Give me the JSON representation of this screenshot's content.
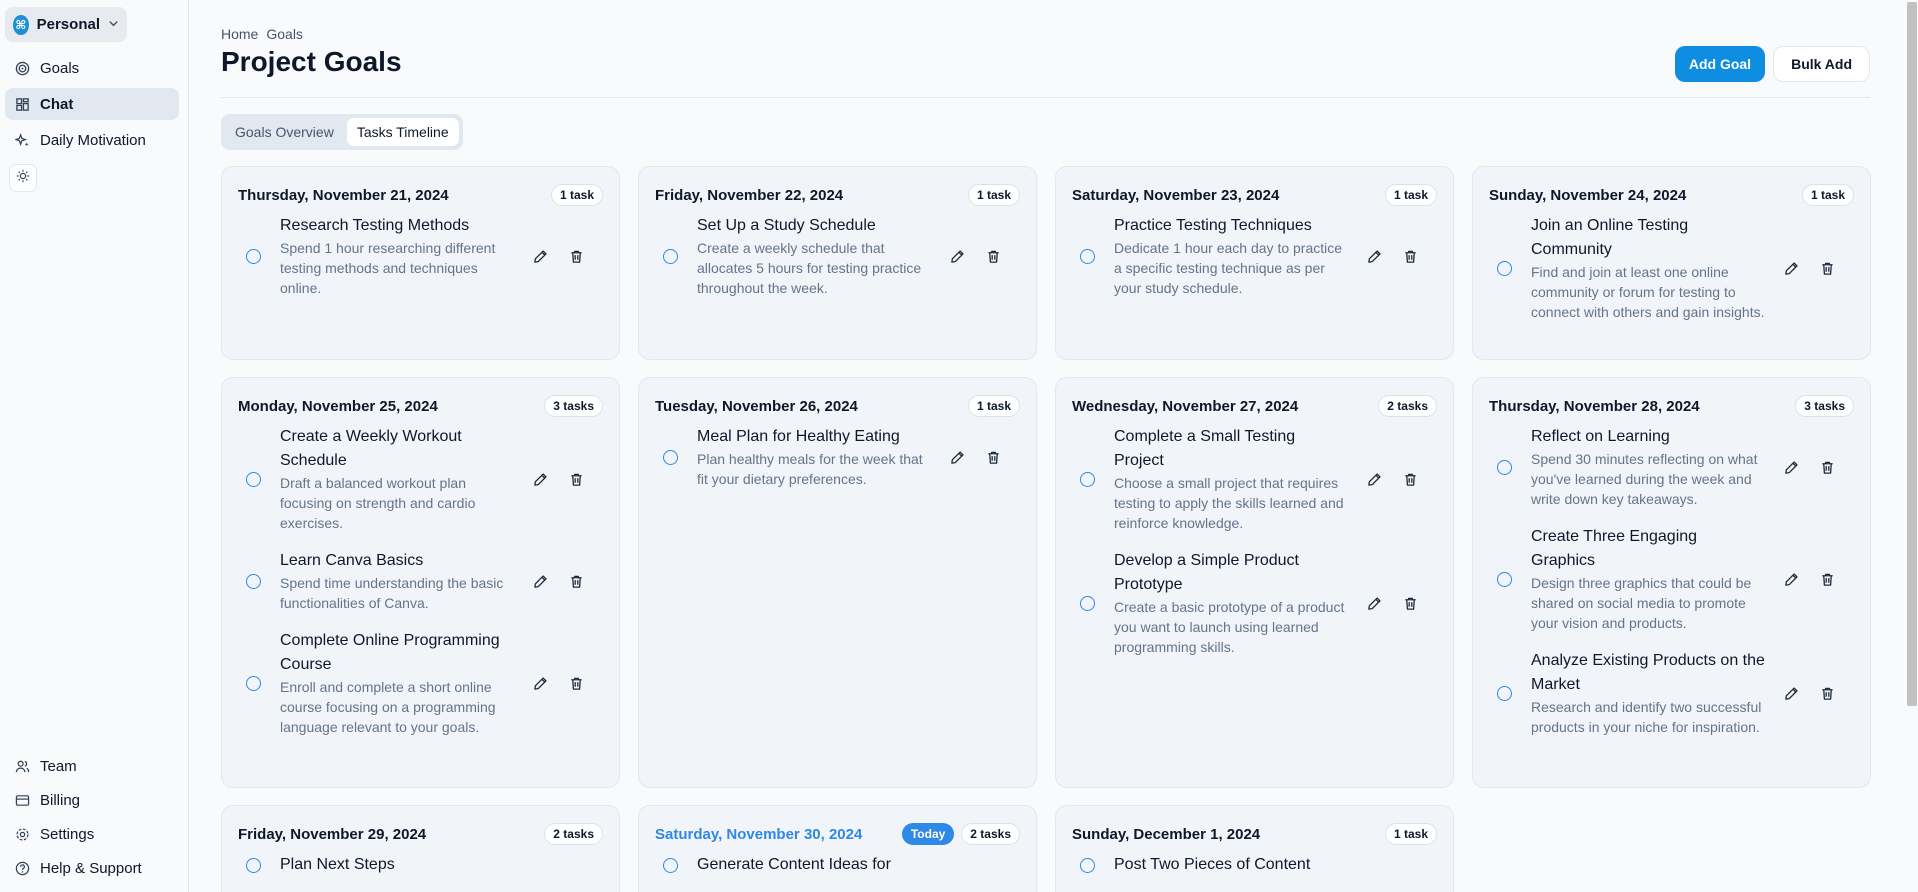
{
  "workspace": {
    "name": "Personal",
    "logo": "⌘"
  },
  "sidebar": {
    "items": [
      {
        "label": "Goals",
        "icon": "target-icon"
      },
      {
        "label": "Chat",
        "icon": "grid-icon"
      },
      {
        "label": "Daily Motivation",
        "icon": "sparkles-icon"
      }
    ],
    "bottom": [
      {
        "label": "Team",
        "icon": "users-icon"
      },
      {
        "label": "Billing",
        "icon": "credit-card-icon"
      },
      {
        "label": "Settings",
        "icon": "gear-icon"
      },
      {
        "label": "Help & Support",
        "icon": "help-icon"
      }
    ]
  },
  "breadcrumb": {
    "home": "Home",
    "current": "Goals"
  },
  "page": {
    "title": "Project Goals",
    "add_goal": "Add Goal",
    "bulk_add": "Bulk Add"
  },
  "tabs": {
    "overview": "Goals Overview",
    "timeline": "Tasks Timeline"
  },
  "days": [
    {
      "date": "Thursday, November 21, 2024",
      "count": "1 task",
      "tasks": [
        {
          "title": "Research Testing Methods",
          "desc": "Spend 1 hour researching different testing methods and techniques online."
        }
      ]
    },
    {
      "date": "Friday, November 22, 2024",
      "count": "1 task",
      "tasks": [
        {
          "title": "Set Up a Study Schedule",
          "desc": "Create a weekly schedule that allocates 5 hours for testing practice throughout the week."
        }
      ]
    },
    {
      "date": "Saturday, November 23, 2024",
      "count": "1 task",
      "tasks": [
        {
          "title": "Practice Testing Techniques",
          "desc": "Dedicate 1 hour each day to practice a specific testing technique as per your study schedule."
        }
      ]
    },
    {
      "date": "Sunday, November 24, 2024",
      "count": "1 task",
      "tasks": [
        {
          "title": "Join an Online Testing Community",
          "desc": "Find and join at least one online community or forum for testing to connect with others and gain insights."
        }
      ]
    },
    {
      "date": "Monday, November 25, 2024",
      "count": "3 tasks",
      "tasks": [
        {
          "title": "Create a Weekly Workout Schedule",
          "desc": "Draft a balanced workout plan focusing on strength and cardio exercises."
        },
        {
          "title": "Learn Canva Basics",
          "desc": "Spend time understanding the basic functionalities of Canva."
        },
        {
          "title": "Complete Online Programming Course",
          "desc": "Enroll and complete a short online course focusing on a programming language relevant to your goals."
        }
      ]
    },
    {
      "date": "Tuesday, November 26, 2024",
      "count": "1 task",
      "tasks": [
        {
          "title": "Meal Plan for Healthy Eating",
          "desc": "Plan healthy meals for the week that fit your dietary preferences."
        }
      ]
    },
    {
      "date": "Wednesday, November 27, 2024",
      "count": "2 tasks",
      "tasks": [
        {
          "title": "Complete a Small Testing Project",
          "desc": "Choose a small project that requires testing to apply the skills learned and reinforce knowledge."
        },
        {
          "title": "Develop a Simple Product Prototype",
          "desc": "Create a basic prototype of a product you want to launch using learned programming skills."
        }
      ]
    },
    {
      "date": "Thursday, November 28, 2024",
      "count": "3 tasks",
      "tasks": [
        {
          "title": "Reflect on Learning",
          "desc": "Spend 30 minutes reflecting on what you've learned during the week and write down key takeaways."
        },
        {
          "title": "Create Three Engaging Graphics",
          "desc": "Design three graphics that could be shared on social media to promote your vision and products."
        },
        {
          "title": "Analyze Existing Products on the Market",
          "desc": "Research and identify two successful products in your niche for inspiration."
        }
      ]
    },
    {
      "date": "Friday, November 29, 2024",
      "count": "2 tasks",
      "tasks": [
        {
          "title": "Plan Next Steps",
          "desc": ""
        }
      ]
    },
    {
      "date": "Saturday, November 30, 2024",
      "count": "2 tasks",
      "today": "Today",
      "tasks": [
        {
          "title": "Generate Content Ideas for",
          "desc": ""
        }
      ]
    },
    {
      "date": "Sunday, December 1, 2024",
      "count": "1 task",
      "tasks": [
        {
          "title": "Post Two Pieces of Content",
          "desc": ""
        }
      ]
    }
  ],
  "colors": {
    "accent": "#0f8de0",
    "today": "#2f87e6",
    "bg": "#f8fafc",
    "card": "#f1f5f9"
  }
}
